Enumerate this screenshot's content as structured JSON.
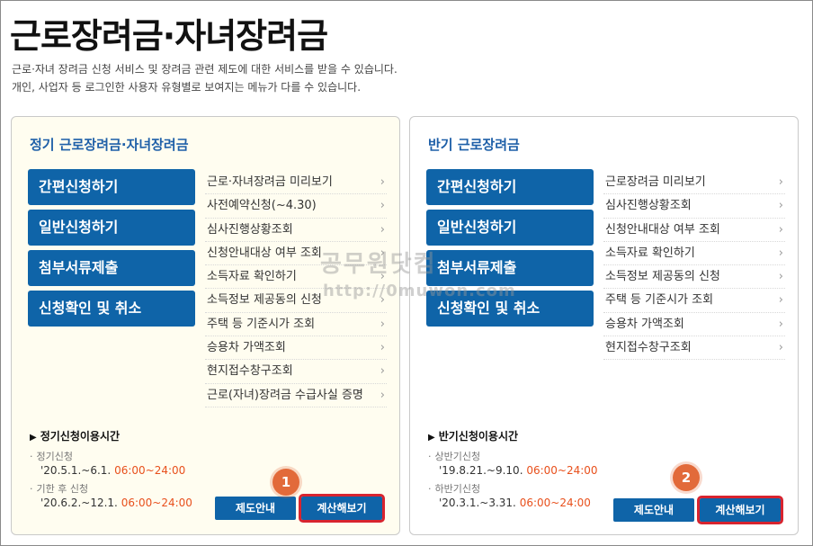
{
  "header": {
    "title": "근로장려금·자녀장려금",
    "desc1": "근로·자녀 장려금 신청 서비스 및 장려금 관련 제도에 대한 서비스를 받을 수 있습니다.",
    "desc2": "개인, 사업자 등 로그인한 사용자 유형별로 보여지는 메뉴가 다를 수 있습니다."
  },
  "left": {
    "title": "정기 근로장려금·자녀장려금",
    "buttons": [
      "간편신청하기",
      "일반신청하기",
      "첨부서류제출",
      "신청확인 및 취소"
    ],
    "links": [
      "근로·자녀장려금 미리보기",
      "사전예약신청(~4.30)",
      "심사진행상황조회",
      "신청안내대상 여부 조회",
      "소득자료 확인하기",
      "소득정보 제공동의 신청",
      "주택 등 기준시가 조회",
      "승용차 가액조회",
      "현지접수창구조회",
      "근로(자녀)장려금 수급사실 증명"
    ],
    "usage": {
      "title": "정기신청이용시간",
      "items": [
        {
          "label": "정기신청",
          "date": "'20.5.1.~6.1.",
          "time": "06:00~24:00"
        },
        {
          "label": "기한 후 신청",
          "date": "'20.6.2.~12.1.",
          "time": "06:00~24:00"
        }
      ]
    },
    "btn_info": "제도안내",
    "btn_calc": "계산해보기",
    "badge": "1"
  },
  "right": {
    "title": "반기 근로장려금",
    "buttons": [
      "간편신청하기",
      "일반신청하기",
      "첨부서류제출",
      "신청확인 및 취소"
    ],
    "links": [
      "근로장려금 미리보기",
      "심사진행상황조회",
      "신청안내대상 여부 조회",
      "소득자료 확인하기",
      "소득정보 제공동의 신청",
      "주택 등 기준시가 조회",
      "승용차 가액조회",
      "현지접수창구조회"
    ],
    "usage": {
      "title": "반기신청이용시간",
      "items": [
        {
          "label": "상반기신청",
          "date": "'19.8.21.~9.10.",
          "time": "06:00~24:00"
        },
        {
          "label": "하반기신청",
          "date": "'20.3.1.~3.31.",
          "time": "06:00~24:00"
        }
      ]
    },
    "btn_info": "제도안내",
    "btn_calc": "계산해보기",
    "badge": "2"
  },
  "watermark": {
    "text": "공무원닷컴",
    "url": "http://0muwon.com"
  },
  "colors": {
    "primary": "#0f64a8",
    "title_blue": "#1e5fa8",
    "time_orange": "#e8501c",
    "highlight_red": "#d8242f",
    "badge": "#e26a3a"
  }
}
